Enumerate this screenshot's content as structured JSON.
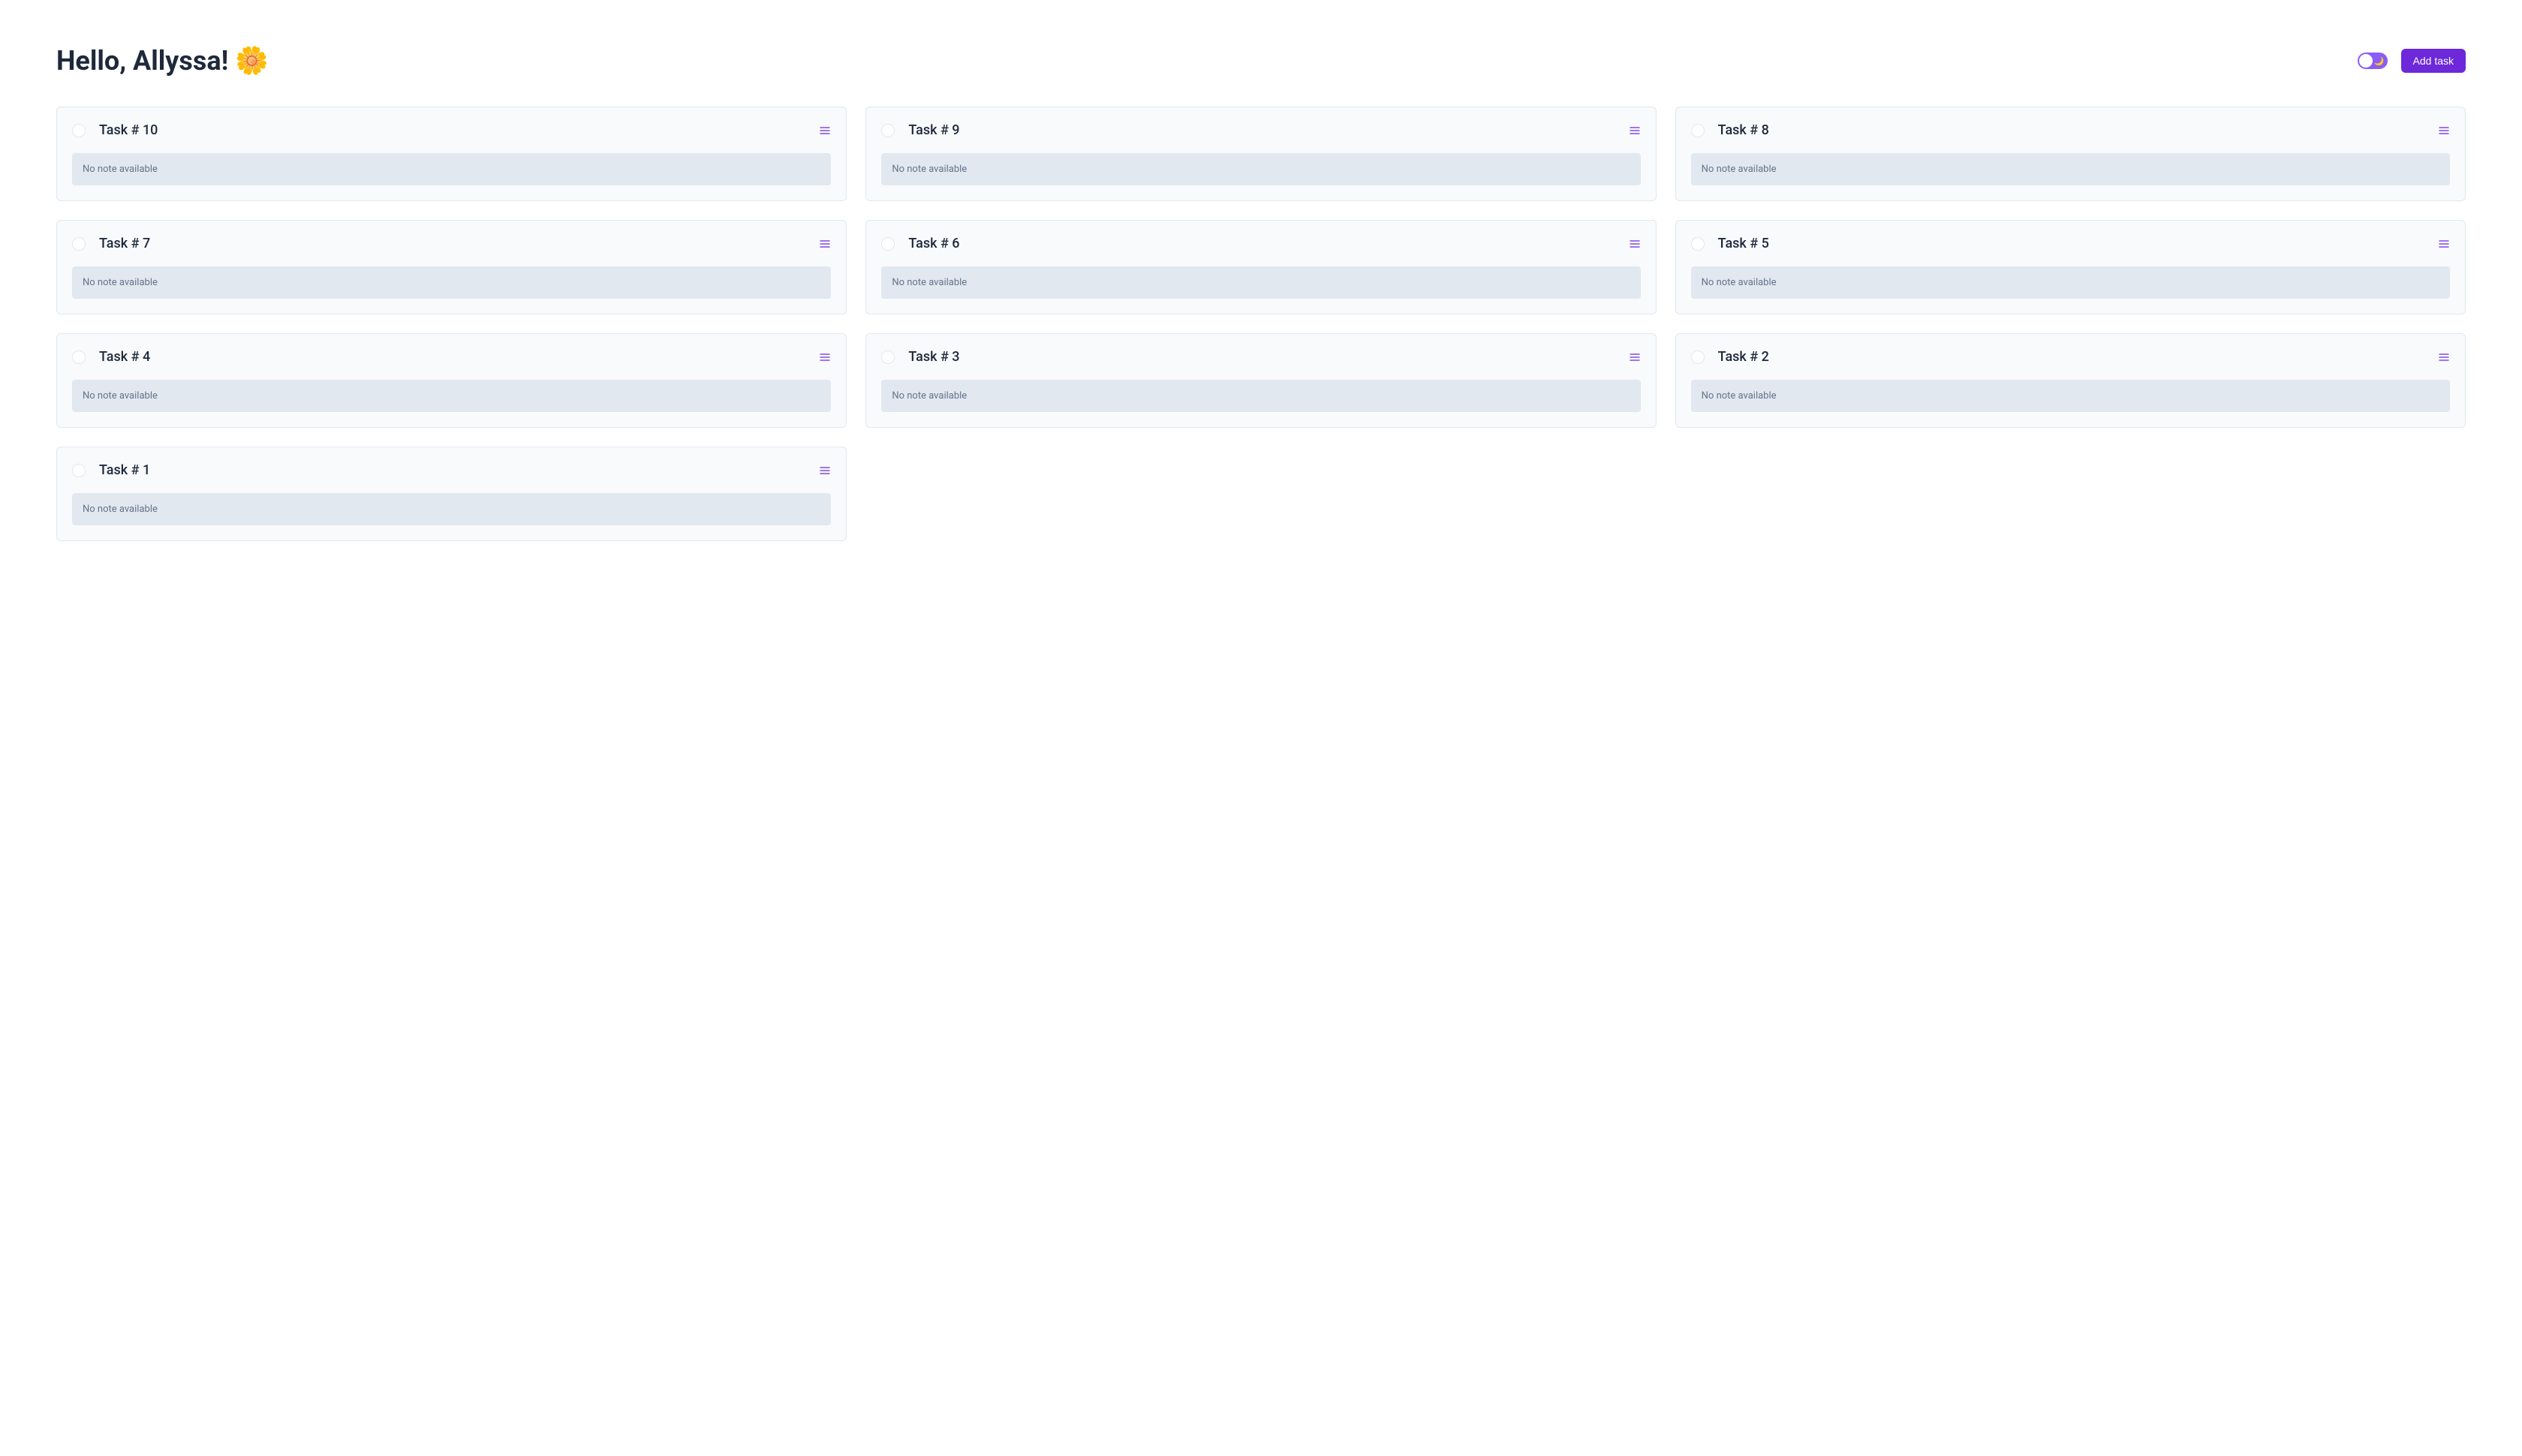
{
  "header": {
    "greeting": "Hello, Allyssa! 🌼",
    "add_task_label": "Add task",
    "toggle_moon": "🌙"
  },
  "colors": {
    "primary": "#6d28d9",
    "card_bg": "#f8fafc",
    "note_bg": "#e2e8f0",
    "text_dark": "#1e293b",
    "text_muted": "#64748b"
  },
  "tasks": [
    {
      "title": "Task # 10",
      "note": "No note available"
    },
    {
      "title": "Task # 9",
      "note": "No note available"
    },
    {
      "title": "Task # 8",
      "note": "No note available"
    },
    {
      "title": "Task # 7",
      "note": "No note available"
    },
    {
      "title": "Task # 6",
      "note": "No note available"
    },
    {
      "title": "Task # 5",
      "note": "No note available"
    },
    {
      "title": "Task # 4",
      "note": "No note available"
    },
    {
      "title": "Task # 3",
      "note": "No note available"
    },
    {
      "title": "Task # 2",
      "note": "No note available"
    },
    {
      "title": "Task # 1",
      "note": "No note available"
    }
  ]
}
